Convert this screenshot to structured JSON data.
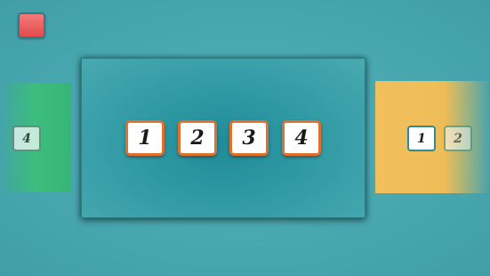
{
  "colors": {
    "background": "#4aa9b2",
    "menu_button": "#e95555",
    "left_panel": "#3dbd7e",
    "center_panel": "#2e98a2",
    "right_panel": "#f1c05e",
    "level_border": "#e0702e"
  },
  "icons": {
    "menu_button": "red-square-button"
  },
  "left_panel": {
    "levels": [
      "4"
    ]
  },
  "center_panel": {
    "levels": [
      "1",
      "2",
      "3",
      "4"
    ]
  },
  "right_panel": {
    "levels": [
      "1",
      "2"
    ]
  }
}
